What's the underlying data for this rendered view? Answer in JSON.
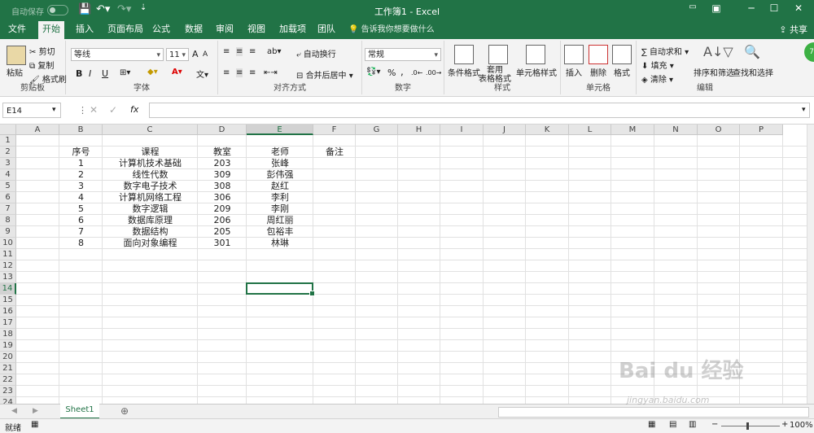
{
  "window": {
    "autosave_label": "自动保存",
    "autosave_state": "关",
    "title": "工作簿1  -  Excel",
    "controls": [
      "—",
      "❐",
      "─",
      "☐",
      "✕"
    ]
  },
  "tabs": [
    "文件",
    "开始",
    "插入",
    "页面布局",
    "公式",
    "数据",
    "审阅",
    "视图",
    "加载项",
    "团队"
  ],
  "active_tab": "开始",
  "tell_me": "告诉我你想要做什么",
  "share": "共享",
  "ribbon": {
    "clipboard": {
      "paste": "粘贴",
      "cut": "剪切",
      "copy": "复制",
      "painter": "格式刷",
      "label": "剪贴板"
    },
    "font": {
      "name": "等线",
      "size": "11",
      "bold": "B",
      "italic": "I",
      "underline": "U",
      "label": "字体"
    },
    "alignment": {
      "wrap": "自动换行",
      "merge": "合并后居中",
      "label": "对齐方式"
    },
    "number": {
      "format": "常规",
      "percent": "%",
      "comma": ",",
      "label": "数字"
    },
    "styles": {
      "conditional": "条件格式",
      "table": "套用\n表格格式",
      "cell": "单元格样式",
      "label": "样式"
    },
    "cells": {
      "insert": "插入",
      "delete": "删除",
      "format": "格式",
      "label": "单元格"
    },
    "editing": {
      "autosum": "自动求和",
      "fill": "填充",
      "clear": "清除",
      "sort": "排序和筛选",
      "find": "查找和选择",
      "label": "编辑"
    }
  },
  "namebox": "E14",
  "fx": "fx",
  "columns": [
    "A",
    "B",
    "C",
    "D",
    "E",
    "F",
    "G",
    "H",
    "I",
    "J",
    "K",
    "L",
    "M",
    "N",
    "O",
    "P"
  ],
  "selected_column": "E",
  "selected_row": 14,
  "rows": [
    "1",
    "2",
    "3",
    "4",
    "5",
    "6",
    "7",
    "8",
    "9",
    "10",
    "11",
    "12",
    "13",
    "14",
    "15",
    "16",
    "17",
    "18",
    "19",
    "20",
    "21",
    "22",
    "23",
    "24"
  ],
  "table": {
    "headers": [
      "序号",
      "课程",
      "教室",
      "老师",
      "备注"
    ],
    "rows": [
      [
        "1",
        "计算机技术基础",
        "203",
        "张峰",
        ""
      ],
      [
        "2",
        "线性代数",
        "309",
        "彭伟强",
        ""
      ],
      [
        "3",
        "数字电子技术",
        "308",
        "赵红",
        ""
      ],
      [
        "4",
        "计算机网络工程",
        "306",
        "李利",
        ""
      ],
      [
        "5",
        "数字逻辑",
        "209",
        "李刚",
        ""
      ],
      [
        "6",
        "数据库原理",
        "206",
        "周红丽",
        ""
      ],
      [
        "7",
        "数据结构",
        "205",
        "包裕丰",
        ""
      ],
      [
        "8",
        "面向对象编程",
        "301",
        "林琳",
        ""
      ]
    ]
  },
  "sheet_tab": "Sheet1",
  "status": {
    "ready": "就绪",
    "zoom": "100%"
  },
  "watermark": "Bai du 经验",
  "watermark_sub": "jingyan.baidu.com"
}
